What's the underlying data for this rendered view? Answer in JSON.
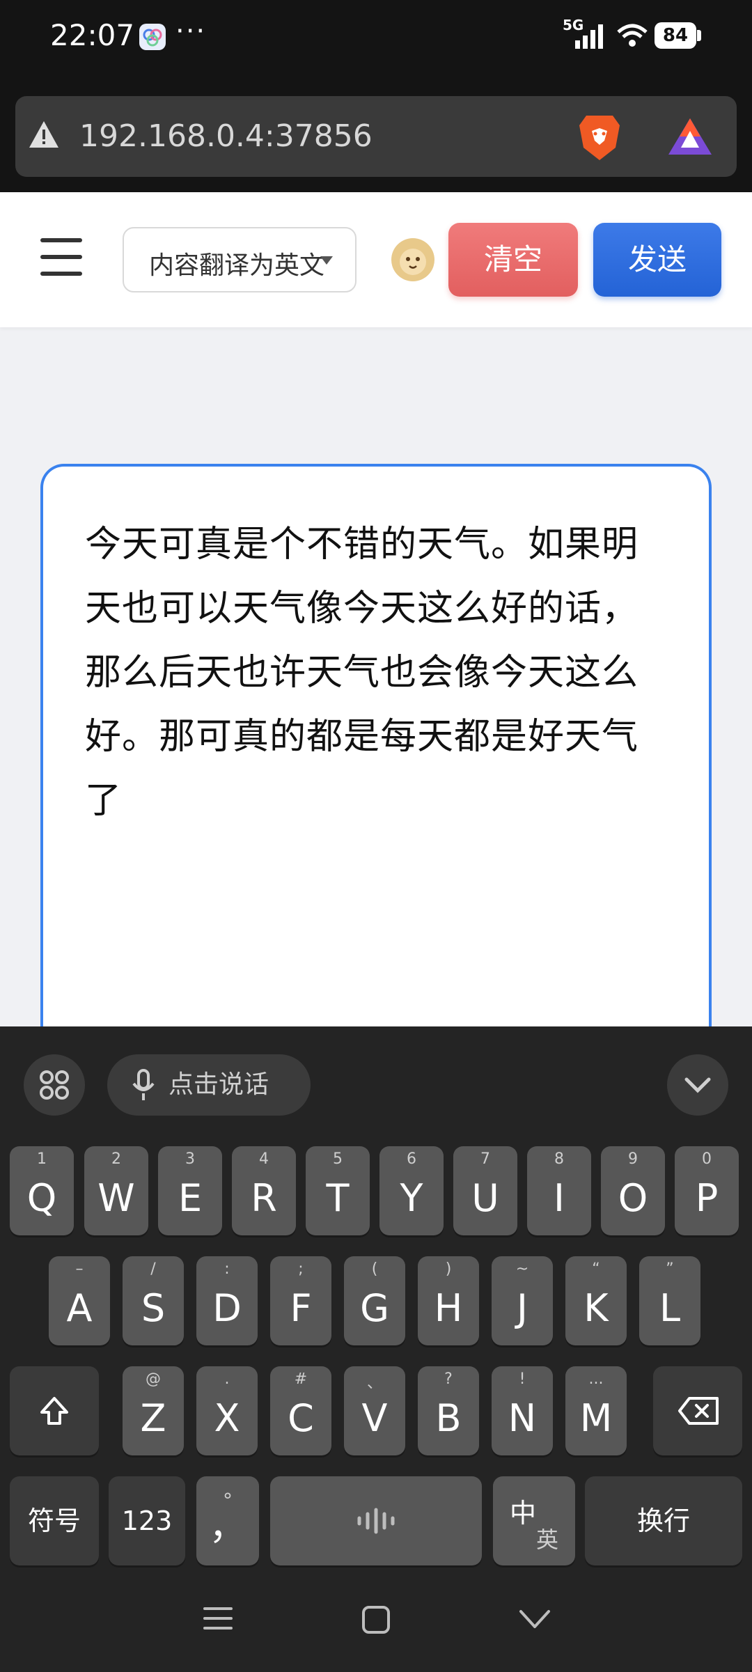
{
  "status_bar": {
    "time": "22:07",
    "more": "···",
    "network": "5G",
    "battery": "84"
  },
  "browser": {
    "url": "192.168.0.4:37856"
  },
  "header": {
    "language_select": "内容翻译为英文",
    "clear_label": "清空",
    "send_label": "发送"
  },
  "editor": {
    "text": "今天可真是个不错的天气。如果明天也可以天气像今天这么好的话，那么后天也许天气也会像今天这么好。那可真的都是每天都是好天气了"
  },
  "keyboard": {
    "voice_label": "点击说话",
    "row1": [
      {
        "key": "Q",
        "sub": "1"
      },
      {
        "key": "W",
        "sub": "2"
      },
      {
        "key": "E",
        "sub": "3"
      },
      {
        "key": "R",
        "sub": "4"
      },
      {
        "key": "T",
        "sub": "5"
      },
      {
        "key": "Y",
        "sub": "6"
      },
      {
        "key": "U",
        "sub": "7"
      },
      {
        "key": "I",
        "sub": "8"
      },
      {
        "key": "O",
        "sub": "9"
      },
      {
        "key": "P",
        "sub": "0"
      }
    ],
    "row2": [
      {
        "key": "A",
        "sub": "–"
      },
      {
        "key": "S",
        "sub": "/"
      },
      {
        "key": "D",
        "sub": ":"
      },
      {
        "key": "F",
        "sub": ";"
      },
      {
        "key": "G",
        "sub": "("
      },
      {
        "key": "H",
        "sub": ")"
      },
      {
        "key": "J",
        "sub": "~"
      },
      {
        "key": "K",
        "sub": "“"
      },
      {
        "key": "L",
        "sub": "”"
      }
    ],
    "row3": [
      {
        "key": "Z",
        "sub": "@"
      },
      {
        "key": "X",
        "sub": "."
      },
      {
        "key": "C",
        "sub": "#"
      },
      {
        "key": "V",
        "sub": "、"
      },
      {
        "key": "B",
        "sub": "?"
      },
      {
        "key": "N",
        "sub": "!"
      },
      {
        "key": "M",
        "sub": "..."
      }
    ],
    "symbols_label": "符号",
    "numbers_label": "123",
    "comma_key": "，",
    "comma_sub": "°",
    "lang_switch_main": "中",
    "lang_switch_sub": "英",
    "enter_label": "换行"
  }
}
